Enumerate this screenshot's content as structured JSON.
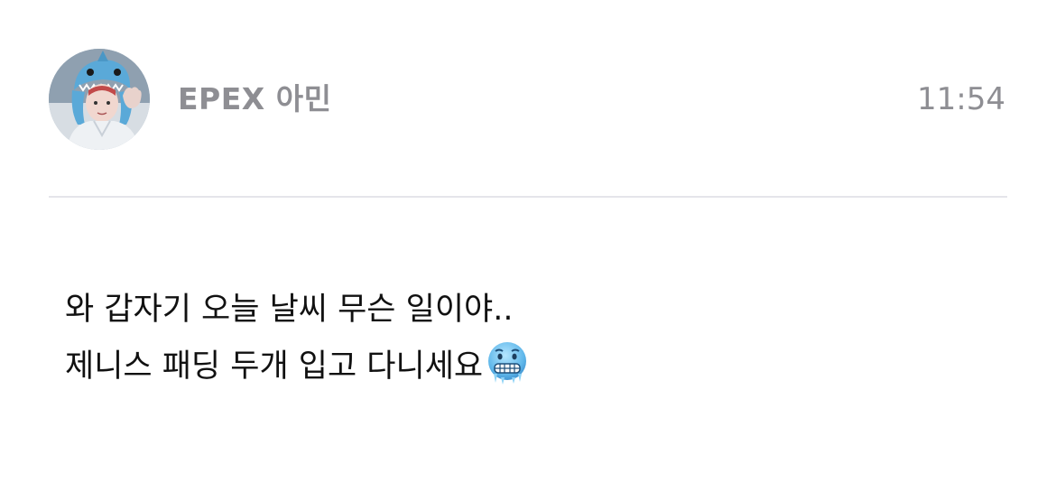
{
  "header": {
    "sender_name": "EPEX 아민",
    "time": "11:54",
    "avatar_icon": "profile-photo-shark-hood"
  },
  "message": {
    "lines": [
      "와 갑자기 오늘 날씨 무슨 일이야..",
      "제니스 패딩 두개 입고 다니세요"
    ],
    "trailing_emoji": "freezing-face-icon"
  },
  "colors": {
    "background": "#ffffff",
    "meta_text": "#8e8e93",
    "body_text": "#111111",
    "divider": "#e5e5ea",
    "emoji_blue": "#6ec3f0"
  }
}
